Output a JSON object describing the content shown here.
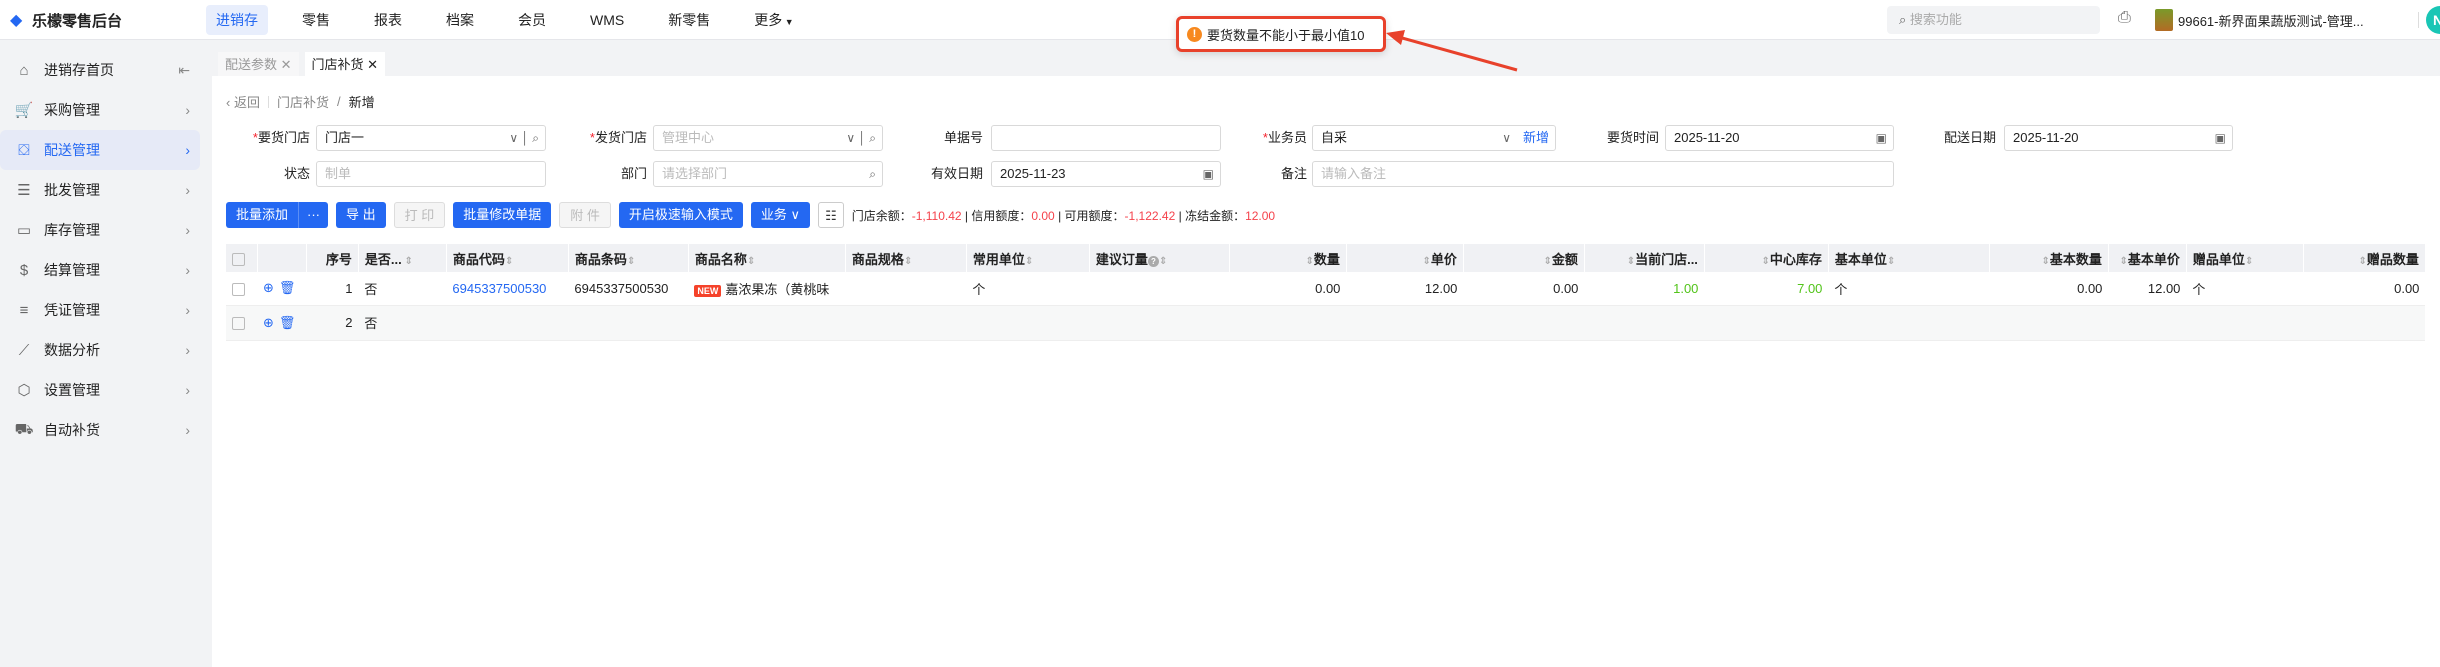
{
  "app": {
    "title": "乐檬零售后台"
  },
  "nav": [
    "进销存",
    "零售",
    "报表",
    "档案",
    "会员",
    "WMS",
    "新零售",
    "更多"
  ],
  "toast": {
    "message": "要货数量不能小于最小值10"
  },
  "header": {
    "search_placeholder": "搜索功能",
    "store_name": "99661-新界面果蔬版测试-管理...",
    "avatar_letter": "N"
  },
  "sidebar": {
    "items": [
      {
        "label": "进销存首页",
        "icon": "⌂"
      },
      {
        "label": "采购管理",
        "icon": "🛒"
      },
      {
        "label": "配送管理",
        "icon": "⛋"
      },
      {
        "label": "批发管理",
        "icon": "☰"
      },
      {
        "label": "库存管理",
        "icon": "▭"
      },
      {
        "label": "结算管理",
        "icon": "$"
      },
      {
        "label": "凭证管理",
        "icon": "≡"
      },
      {
        "label": "数据分析",
        "icon": "⟋"
      },
      {
        "label": "设置管理",
        "icon": "⬡"
      },
      {
        "label": "自动补货",
        "icon": "⛟"
      }
    ]
  },
  "tabs": [
    {
      "label": "配送参数 ✕"
    },
    {
      "label": "门店补货 ✕"
    }
  ],
  "breadcrumb": {
    "back": "返回",
    "parent": "门店补货",
    "current": "新增"
  },
  "form": {
    "req_store": {
      "label": "要货门店",
      "value": "门店一"
    },
    "ship_store": {
      "label": "发货门店",
      "value": "管理中心"
    },
    "doc_no": {
      "label": "单据号",
      "value": ""
    },
    "clerk": {
      "label": "业务员",
      "value": "自采",
      "link": "新增"
    },
    "req_time": {
      "label": "要货时间",
      "value": "2025-11-20"
    },
    "ship_date": {
      "label": "配送日期",
      "value": "2025-11-20"
    },
    "status": {
      "label": "状态",
      "value": "制单"
    },
    "dept": {
      "label": "部门",
      "placeholder": "请选择部门"
    },
    "valid_date": {
      "label": "有效日期",
      "value": "2025-11-23"
    },
    "remark": {
      "label": "备注",
      "placeholder": "请输入备注"
    }
  },
  "toolbar": {
    "batch_add": "批量添加",
    "more": "···",
    "export": "导 出",
    "print": "打 印",
    "batch_edit": "批量修改单据",
    "attach": "附 件",
    "fast_mode": "开启极速输入模式",
    "business": "业务 ∨"
  },
  "stats": {
    "balance_label": "门店余额：",
    "balance": "-1,110.42",
    "credit_label": "信用额度：",
    "credit": "0.00",
    "available_label": "可用额度：",
    "available": "-1,122.42",
    "frozen_label": "冻结金额：",
    "frozen": "12.00"
  },
  "table": {
    "headers": [
      "序号",
      "是否...",
      "商品代码",
      "商品条码",
      "商品名称",
      "商品规格",
      "常用单位",
      "建议订量",
      "数量",
      "单价",
      "金额",
      "当前门店...",
      "中心库存",
      "基本单位",
      "基本数量",
      "基本单价",
      "赠品单位",
      "赠品数量"
    ],
    "rows": [
      {
        "seq": "1",
        "flag": "否",
        "code": "6945337500530",
        "barcode": "6945337500530",
        "badge": "NEW",
        "name": "嘉浓果冻（黄桃味",
        "spec": "",
        "unit": "个",
        "suggest": "",
        "qty": "0.00",
        "price": "12.00",
        "amount": "0.00",
        "store_stock": "1.00",
        "center_stock": "7.00",
        "base_unit": "个",
        "base_qty": "0.00",
        "base_price": "12.00",
        "gift_unit": "个",
        "gift_qty": "0.00"
      },
      {
        "seq": "2",
        "flag": "否"
      }
    ]
  }
}
